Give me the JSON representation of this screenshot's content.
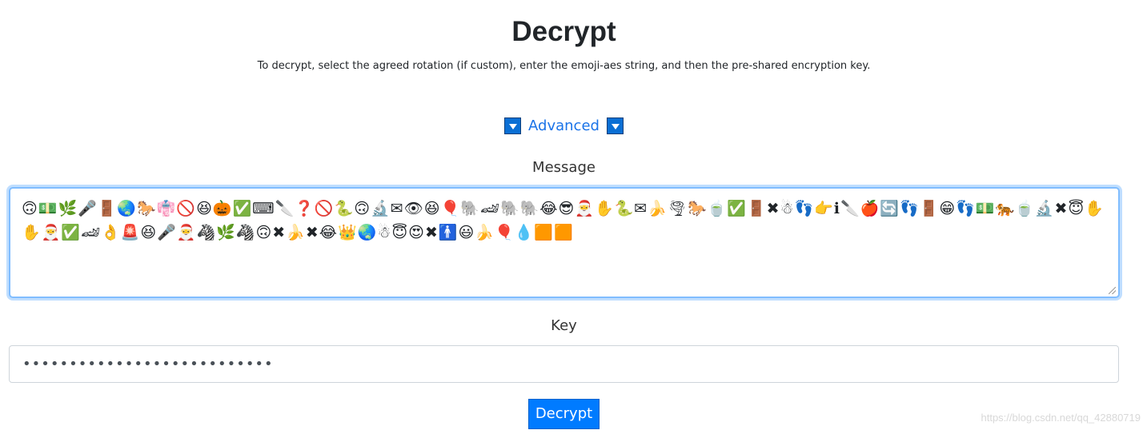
{
  "header": {
    "title": "Decrypt",
    "subtitle": "To decrypt, select the agreed rotation (if custom), enter the emoji-aes string, and then the pre-shared encryption key."
  },
  "advanced": {
    "label": "Advanced",
    "icon": "triangle-down-icon"
  },
  "message": {
    "label": "Message",
    "value": "🙃💵🌿🎤🚪🌏🐎👘🚫😆🎃✅⌨🔪❓🚫🐍🙃🔬✉👁😆🎈🐘🏎🐘🐘😂😎🎅✋🐍✉🍌🌪🐎🍵✅🚪✖☃👣👉ℹ🔪🍎🔄👣🚪😁👣💵🐅🍵🔬✖😇✋✋🎅✅🏎👌🚨😆🎤🎅🦓🌿🦓🙃✖🍌✖😂👑🌏☃😇😍✖🚹😃🍌🎈💧🟧🟧"
  },
  "key": {
    "label": "Key",
    "value": "•••••••••••••••••••••••••••"
  },
  "actions": {
    "decrypt_label": "Decrypt"
  },
  "watermark": "https://blog.csdn.net/qq_42880719",
  "colors": {
    "primary": "#007bff",
    "link": "#1a73e8",
    "focus_border": "#80bdff"
  }
}
